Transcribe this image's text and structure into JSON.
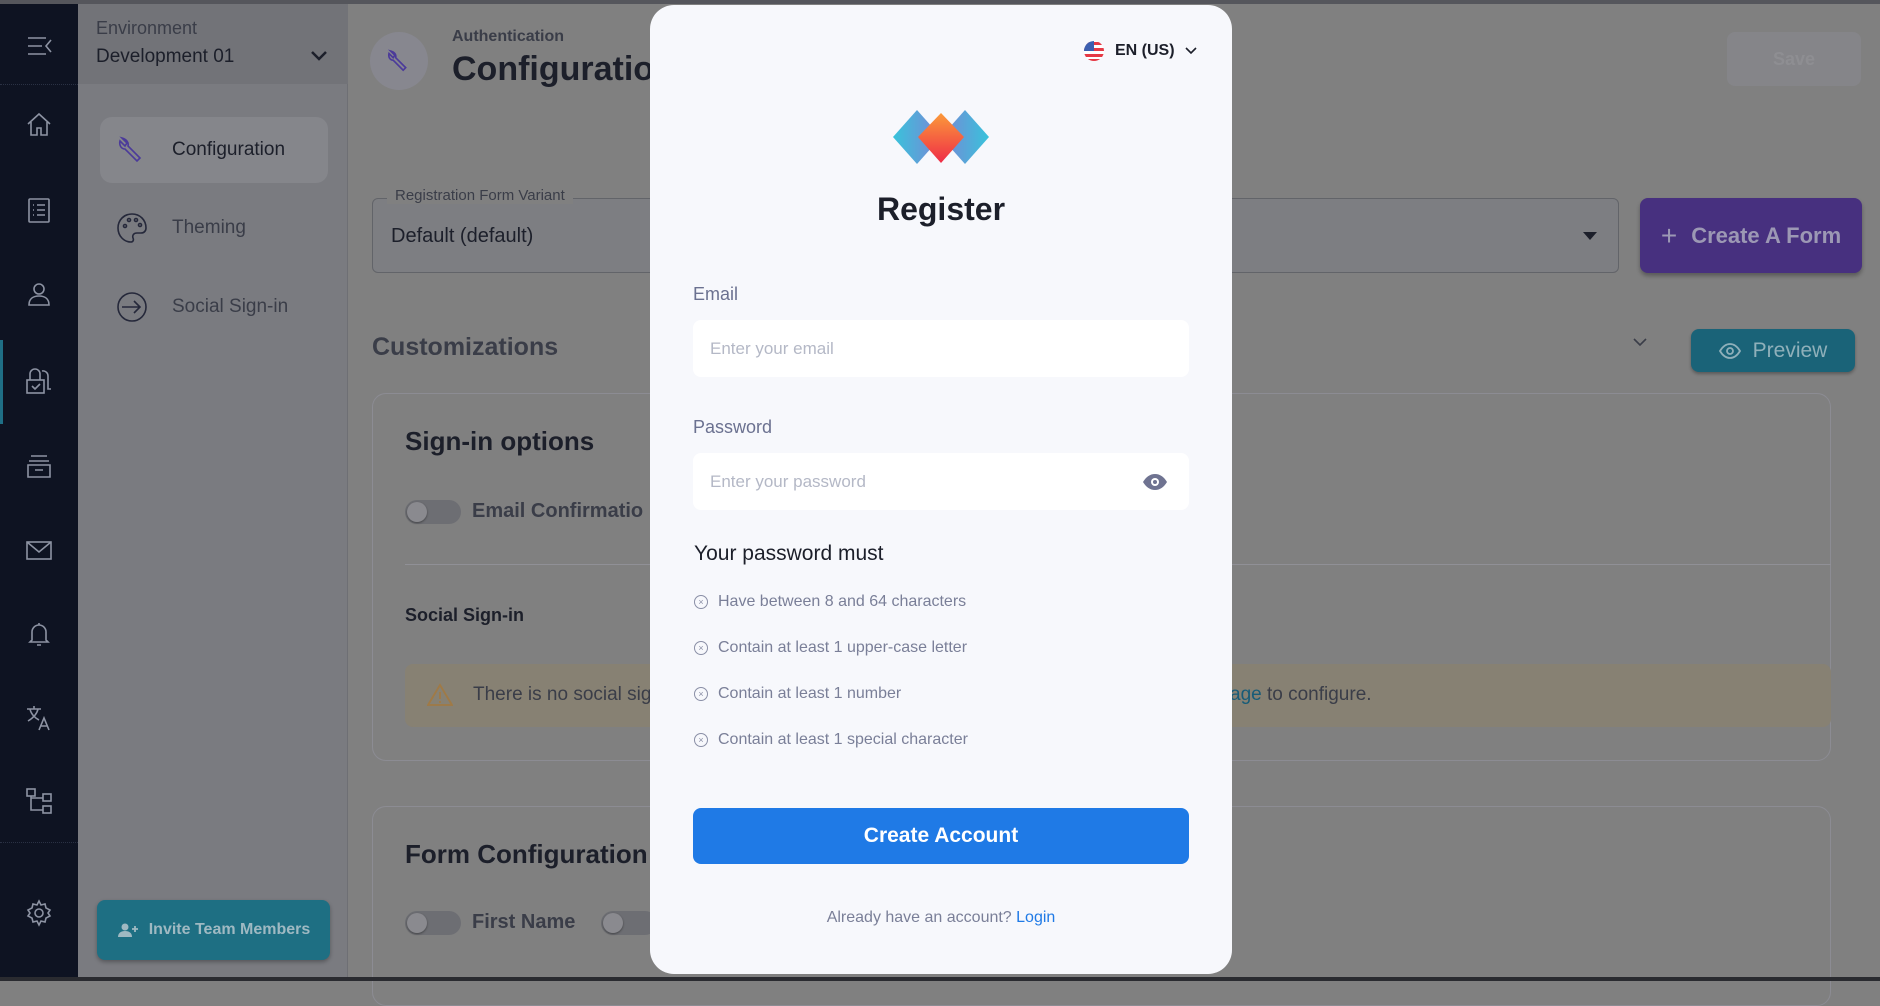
{
  "sidebar_rail": {
    "icons": [
      "menu-collapse-icon",
      "home-icon",
      "list-icon",
      "user-icon",
      "lock-check-icon",
      "archive-icon",
      "mail-icon",
      "bell-icon",
      "translate-icon",
      "hierarchy-icon",
      "gear-icon"
    ],
    "active": "lock-check-icon"
  },
  "environment": {
    "label": "Environment",
    "value": "Development 01"
  },
  "subnav": {
    "items": [
      {
        "label": "Configuration",
        "icon": "wrench-icon",
        "active": true
      },
      {
        "label": "Theming",
        "icon": "palette-icon"
      },
      {
        "label": "Social Sign-in",
        "icon": "sign-in-icon"
      }
    ],
    "invite_label": "Invite Team Members"
  },
  "header": {
    "breadcrumb": "Authentication",
    "title": "Configuration",
    "save_label": "Save"
  },
  "form_variant": {
    "label": "Registration Form Variant",
    "value": "Default (default)",
    "create_label": "Create A Form"
  },
  "customizations": {
    "title": "Customizations",
    "preview_label": "Preview"
  },
  "signin_options": {
    "title": "Sign-in options",
    "email_confirmation": "Email Confirmatio",
    "social_title": "Social Sign-in",
    "warning_left": "There is no social sig",
    "warning_link": "age",
    "warning_right": " to configure."
  },
  "form_config": {
    "title": "Form Configuration",
    "first_name": "First Name"
  },
  "modal": {
    "language": "EN (US)",
    "title": "Register",
    "email_label": "Email",
    "email_placeholder": "Enter your email",
    "password_label": "Password",
    "password_placeholder": "Enter your password",
    "rules_title": "Your password must",
    "rules": [
      "Have between 8 and 64 characters",
      "Contain at least 1 upper-case letter",
      "Contain at least 1 number",
      "Contain at least 1 special character"
    ],
    "create_label": "Create Account",
    "login_prompt": "Already have an account?",
    "login_link": "Login"
  },
  "colors": {
    "primary": "#1f7ae6",
    "create_form": "#47307f",
    "preview": "#1a6378",
    "invite": "#1e6f83"
  }
}
